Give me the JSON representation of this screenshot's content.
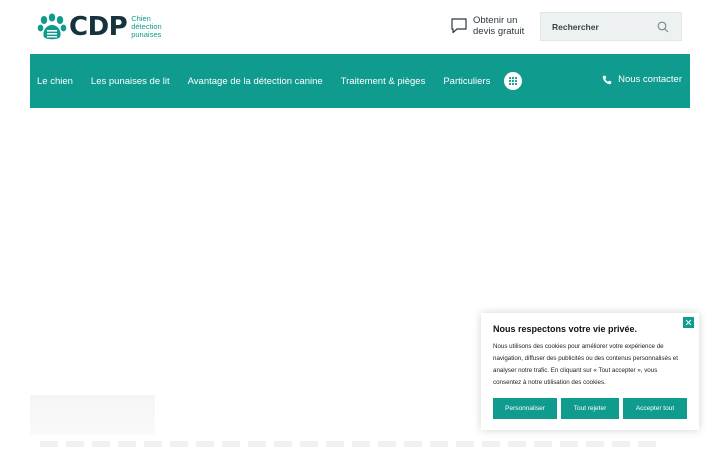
{
  "logo": {
    "name": "CDP",
    "tagline": [
      "Chien",
      "détection",
      "punaises"
    ]
  },
  "header": {
    "quote_lines": [
      "Obtenir un",
      "devis gratuit"
    ],
    "search": {
      "placeholder": "Rechercher",
      "icon": "search-icon"
    }
  },
  "nav": {
    "items": [
      {
        "label": "Le chien"
      },
      {
        "label": "Les punaises de lit"
      },
      {
        "label": "Avantage de la détection canine"
      },
      {
        "label": "Traitement & pièges"
      },
      {
        "label": "Particuliers"
      }
    ],
    "more_icon": "grid-icon",
    "contact_label": "Nous contacter",
    "contact_icon": "phone-icon"
  },
  "cookie": {
    "title": "Nous respectons votre vie privée.",
    "text": "Nous utilisons des cookies pour améliorer votre expérience de navigation, diffuser des publicités ou des contenus personnalisés et analyser notre trafic. En cliquant sur « Tout accepter », vous consentez à notre utilisation des cookies.",
    "buttons": {
      "customize": "Personnaliser",
      "reject": "Tout rejeter",
      "accept": "Accepter tout"
    }
  },
  "colors": {
    "brand": "#0f9b8e",
    "logo_dark": "#16333d"
  }
}
